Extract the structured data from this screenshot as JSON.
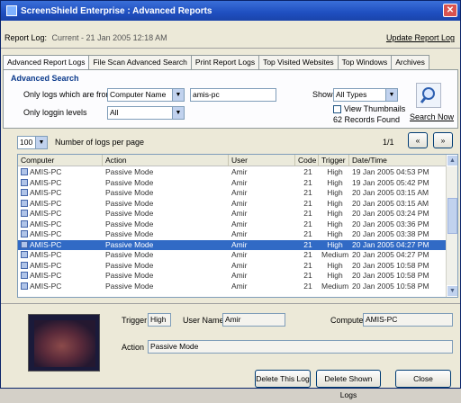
{
  "window": {
    "title": "ScreenShield Enterprise : Advanced Reports"
  },
  "header": {
    "report_log_label": "Report Log:",
    "current_label": "Current - 21 Jan 2005 12:18 AM",
    "update_link": "Update Report Log"
  },
  "tabs": [
    {
      "label": "Advanced Report Logs",
      "active": true
    },
    {
      "label": "File Scan Advanced Search",
      "active": false
    },
    {
      "label": "Print Report Logs",
      "active": false
    },
    {
      "label": "Top Visited Websites",
      "active": false
    },
    {
      "label": "Top Windows",
      "active": false
    },
    {
      "label": "Archives",
      "active": false
    }
  ],
  "search": {
    "group_title": "Advanced Search",
    "only_items_label": "Only logs which are from",
    "field_select": "Computer Name",
    "field_value": "amis-pc",
    "only_levels_label": "Only loggin levels",
    "level_select": "All",
    "show_label": "Show",
    "show_select": "All Types",
    "thumbnails_label": "View Thumbnails",
    "records_found": "62 Records Found",
    "search_button": "Search Now"
  },
  "paging": {
    "per_page": "100",
    "per_page_label": "Number of logs per page",
    "page_text": "1/1",
    "prev_icon": "«",
    "next_icon": "»"
  },
  "table": {
    "columns": [
      "Computer",
      "Action",
      "User",
      "Code",
      "Trigger",
      "Date/Time"
    ],
    "rows": [
      [
        "AMIS-PC",
        "Passive Mode",
        "Amir",
        "21",
        "High",
        "19 Jan 2005 04:53 PM"
      ],
      [
        "AMIS-PC",
        "Passive Mode",
        "Amir",
        "21",
        "High",
        "19 Jan 2005 05:42 PM"
      ],
      [
        "AMIS-PC",
        "Passive Mode",
        "Amir",
        "21",
        "High",
        "20 Jan 2005 03:15 AM"
      ],
      [
        "AMIS-PC",
        "Passive Mode",
        "Amir",
        "21",
        "High",
        "20 Jan 2005 03:15 AM"
      ],
      [
        "AMIS-PC",
        "Passive Mode",
        "Amir",
        "21",
        "High",
        "20 Jan 2005 03:24 PM"
      ],
      [
        "AMIS-PC",
        "Passive Mode",
        "Amir",
        "21",
        "High",
        "20 Jan 2005 03:36 PM"
      ],
      [
        "AMIS-PC",
        "Passive Mode",
        "Amir",
        "21",
        "High",
        "20 Jan 2005 03:38 PM"
      ],
      [
        "AMIS-PC",
        "Passive Mode",
        "Amir",
        "21",
        "High",
        "20 Jan 2005 04:27 PM"
      ],
      [
        "AMIS-PC",
        "Passive Mode",
        "Amir",
        "21",
        "Medium",
        "20 Jan 2005 04:27 PM"
      ],
      [
        "AMIS-PC",
        "Passive Mode",
        "Amir",
        "21",
        "High",
        "20 Jan 2005 10:58 PM"
      ],
      [
        "AMIS-PC",
        "Passive Mode",
        "Amir",
        "21",
        "High",
        "20 Jan 2005 10:58 PM"
      ],
      [
        "AMIS-PC",
        "Passive Mode",
        "Amir",
        "21",
        "Medium",
        "20 Jan 2005 10:58 PM"
      ]
    ],
    "selected_row": 7
  },
  "details": {
    "trigger_label": "Trigger",
    "trigger_value": "High",
    "user_label": "User Name",
    "user_value": "Amir",
    "computer_label": "Computer",
    "computer_value": "AMIS-PC",
    "action_label": "Action",
    "action_value": "Passive Mode"
  },
  "buttons": {
    "delete_this": "Delete This Log",
    "delete_shown": "Delete Shown Logs",
    "close": "Close"
  },
  "colors": {
    "titlebar": "#1f4fc0",
    "selection": "#316ac5"
  }
}
